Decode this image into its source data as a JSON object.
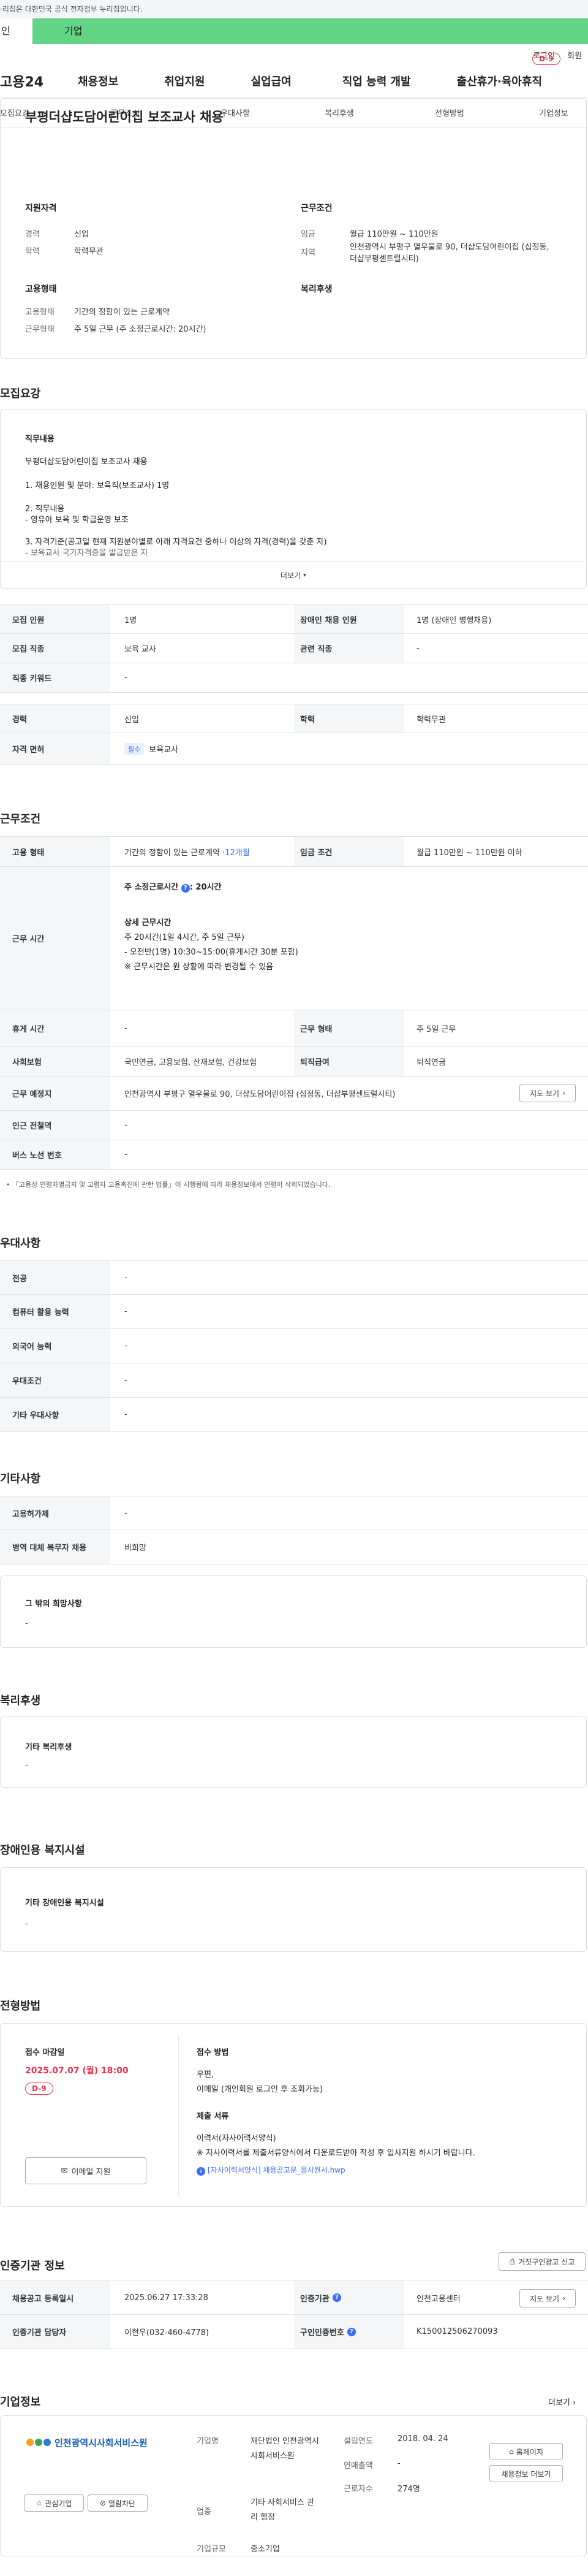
{
  "topbar": {
    "text": "·리집은 대한민국 공식 전자정부 누리집입니다."
  },
  "tabs": {
    "individual": "인",
    "corporate": "기업"
  },
  "util": {
    "login": "로그인",
    "join": "회원"
  },
  "gnb": {
    "logo": "고용24",
    "menu": [
      "채용정보",
      "취업지원",
      "실업급여",
      "직업 능력 개발",
      "출산휴가·육아휴직"
    ]
  },
  "subnav": [
    "모집요강",
    "근무조건",
    "우대사항",
    "복리후생",
    "전형방법",
    "기업정보"
  ],
  "job": {
    "title": "부평더샵도담어린이집 보조교사 채용",
    "dday": "D-9",
    "qual_title": "지원자격",
    "career_label": "경력",
    "career_value": "신입",
    "edu_label": "학력",
    "edu_value": "학력무관",
    "cond_title": "근무조건",
    "wage_label": "임금",
    "wage_value": "월급 110만원 ~ 110만원",
    "area_label": "지역",
    "area_value": "인천광역시 부평구 열우물로 90, 더샵도담어린이집 (십정동, 더샵부평센트럴시티)",
    "emp_title": "고용형태",
    "emp_label": "고용형태",
    "emp_value": "기간의 정함이 있는 근로계약",
    "work_label": "근무형태",
    "work_value": "주 5일 근무 (주 소정근로시간: 20시간)",
    "welfare_title": "복리후생"
  },
  "recruit": {
    "title": "모집요강",
    "duty_title": "직무내용",
    "duty_lines": [
      "부평더샵도담어린이집 보조교사 채용",
      "1. 채용인원 및 분야: 보육직(보조교사) 1명",
      "2. 직무내용",
      "- 영유아 보육 및 학급운영 보조",
      "3. 자격기준(공고일 현재 지원분야별로 아래 자격요건 중하나 이상의 자격(경력)을 갖춘 자)",
      "- 보육교사 국가자격증을 발급받은 자"
    ],
    "more": "더보기",
    "rows": [
      {
        "k": "모집 인원",
        "v": "1명",
        "k2": "장애인 채용 인원",
        "v2": "1명 (장애인 병행채용)"
      },
      {
        "k": "모집 직종",
        "v": "보육 교사",
        "k2": "관련 직종",
        "v2": "-"
      },
      {
        "k": "직종 키워드",
        "v": "-"
      },
      {
        "k": "경력",
        "v": "신입",
        "k2": "학력",
        "v2": "학력무관"
      },
      {
        "k": "자격 면허",
        "tag": "필수",
        "v": "보육교사"
      }
    ]
  },
  "work": {
    "title": "근무조건",
    "emp_k": "고용 형태",
    "emp_v": "기간의 정함이 있는 근로계약 · ",
    "emp_period": "12개월",
    "wage_k": "임금 조건",
    "wage_v": "월급 110만원 ~ 110만원 이하",
    "time_k": "근무 시간",
    "time_main": "주 소정근로시간",
    "time_hours": ": 20시간",
    "time_detail_title": "상세 근무시간",
    "time_lines": [
      "주 20시간(1일 4시간, 주 5일 근무)",
      "- 오전반(1명) 10:30~15:00(휴게시간 30분 포함)",
      "※ 근무시간은 원 상황에 따라 변경될 수 있음"
    ],
    "rest_k": "휴게 시간",
    "rest_v": "-",
    "form_k": "근무 형태",
    "form_v": "주 5일 근무",
    "ins_k": "사회보험",
    "ins_v": "국민연금, 고용보험, 산재보험, 건강보험",
    "ret_k": "퇴직급여",
    "ret_v": "퇴직연금",
    "place_k": "근무 예정지",
    "place_v": "인천광역시 부평구 열우물로 90, 더샵도담어린이집 (십정동, 더샵부평센트럴시티)",
    "map_btn": "지도 보기",
    "subway_k": "인근 전철역",
    "subway_v": "-",
    "bus_k": "버스 노선 번호",
    "bus_v": "-",
    "note": "「고용상 연령차별금지 및 고령자 고용촉진에 관한 법률」이 시행됨에 따라 채용정보에서 연령이 삭제되었습니다."
  },
  "pref": {
    "title": "우대사항",
    "rows": [
      {
        "k": "전공",
        "v": "-"
      },
      {
        "k": "컴퓨터 활용 능력",
        "v": "-"
      },
      {
        "k": "외국어 능력",
        "v": "-"
      },
      {
        "k": "우대조건",
        "v": "-"
      },
      {
        "k": "기타 우대사항",
        "v": "-"
      }
    ]
  },
  "etc": {
    "title": "기타사항",
    "rows": [
      {
        "k": "고용허가제",
        "v": "-"
      },
      {
        "k": "병역 대체 복무자 채용",
        "v": "비희망"
      }
    ],
    "other_title": "그 밖의 희망사항",
    "other_v": "-"
  },
  "welfare": {
    "title": "복리후생",
    "box_title": "기타 복리후생",
    "box_v": "-"
  },
  "disab": {
    "title": "장애인용 복지시설",
    "box_title": "기타 장애인용 복지시설",
    "box_v": "-"
  },
  "screening": {
    "title": "전형방법",
    "deadline_label": "접수 마감일",
    "deadline": "2025.07.07 (월) 18:00",
    "dday": "D-9",
    "apply_btn": "이메일 지원",
    "method_title": "접수 방법",
    "method_lines": [
      "우편,",
      "이메일 (개인회원 로그인 후 조회가능)"
    ],
    "doc_title": "제출 서류",
    "doc_lines": [
      "이력서(자사이력서양식)",
      "※ 자사이력서를 제출서류양식에서 다운로드받아 작성 후 입사지원 하시기 바랍니다."
    ],
    "file": "[자사이력서양식] 채용공고문_응시원서.hwp"
  },
  "cert": {
    "title": "인증기관 정보",
    "report_btn": "거짓구인광고 신고",
    "rows": [
      {
        "k": "채용공고 등록일시",
        "v": "2025.06.27 17:33:28",
        "k2": "인증기관",
        "v2": "인천고용센터",
        "btn": "지도 보기"
      },
      {
        "k": "인증기관 담당자",
        "v": "이현우(032-460-4778)",
        "k2": "구인인증번호",
        "v2": "K150012506270093"
      }
    ]
  },
  "company": {
    "title": "기업정보",
    "more": "더보기",
    "logo_text": "인천광역시사회서비스원",
    "interest_btn": "관심기업",
    "block_btn": "열람차단",
    "type_label": "기업명",
    "type_v": "재단법인 인천광역시 사회서비스원",
    "ind_label": "업종",
    "ind_v": "기타 사회서비스 관리 행정",
    "scale_label": "기업규모",
    "scale_v": "중소기업",
    "est_label": "설립연도",
    "est_v": "2018. 04. 24",
    "sales_label": "연매출액",
    "sales_v": "-",
    "emp_label": "근로자수",
    "emp_v": "274명",
    "home_btn": "홈페이지",
    "list_btn": "채용정보 더보기"
  },
  "colors": {
    "accent": "#63d385",
    "dday": "#e8344e",
    "link": "#3b6cff"
  }
}
